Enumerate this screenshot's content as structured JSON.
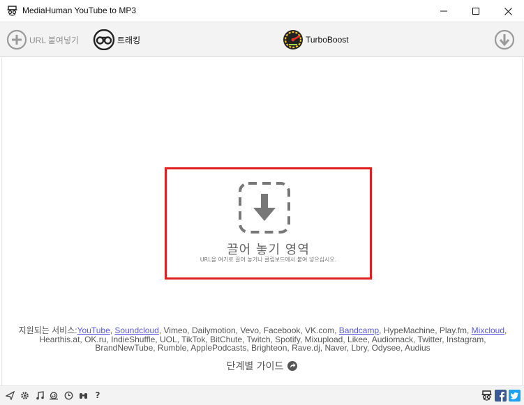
{
  "window": {
    "title": "MediaHuman YouTube to MP3"
  },
  "toolbar": {
    "paste_url_label": "URL 붙여넣기",
    "tracking_label": "트래킹",
    "turboboost_label": "TurboBoost"
  },
  "dropzone": {
    "title": "끌어 놓기 영역",
    "subtitle": "URL을 여기로 끌어 놓거나 클립보드에서 붙여 넣으십시오."
  },
  "services": {
    "intro": "지원되는 서비스:",
    "items": [
      {
        "name": "YouTube",
        "link": true
      },
      {
        "name": "Soundcloud",
        "link": true
      },
      {
        "name": "Vimeo",
        "link": false
      },
      {
        "name": "Dailymotion",
        "link": false
      },
      {
        "name": "Vevo",
        "link": false
      },
      {
        "name": "Facebook",
        "link": false
      },
      {
        "name": "VK.com",
        "link": false
      },
      {
        "name": "Bandcamp",
        "link": true
      },
      {
        "name": "HypeMachine",
        "link": false
      },
      {
        "name": "Play.fm",
        "link": false
      },
      {
        "name": "Mixcloud",
        "link": true
      },
      {
        "name": "Hearthis.at",
        "link": false
      },
      {
        "name": "OK.ru",
        "link": false
      },
      {
        "name": "IndieShuffle",
        "link": false
      },
      {
        "name": "UOL",
        "link": false
      },
      {
        "name": "TikTok",
        "link": false
      },
      {
        "name": "BitChute",
        "link": false
      },
      {
        "name": "Twitch",
        "link": false
      },
      {
        "name": "Spotify",
        "link": false
      },
      {
        "name": "Mixupload",
        "link": false
      },
      {
        "name": "Likee",
        "link": false
      },
      {
        "name": "Audiomack",
        "link": false
      },
      {
        "name": "Twitter",
        "link": false
      },
      {
        "name": "Instagram",
        "link": false
      },
      {
        "name": "BrandNewTube",
        "link": false
      },
      {
        "name": "Rumble",
        "link": false
      },
      {
        "name": "ApplePodcasts",
        "link": false
      },
      {
        "name": "Brighteon",
        "link": false
      },
      {
        "name": "Rave.dj",
        "link": false
      },
      {
        "name": "Naver",
        "link": false
      },
      {
        "name": "Lbry",
        "link": false
      },
      {
        "name": "Odysee",
        "link": false
      },
      {
        "name": "Audius",
        "link": false
      }
    ]
  },
  "guide": {
    "label": "단계별 가이드"
  },
  "statusbar": {
    "left_icons": [
      "send-icon",
      "gear-icon",
      "music-note-icon",
      "snail-icon",
      "clock-icon",
      "binoculars-icon",
      "help-icon"
    ],
    "right_icons": [
      "mediahuman-icon",
      "facebook-icon",
      "twitter-icon"
    ]
  },
  "colors": {
    "dropzone_border": "#e02020",
    "link": "#5a5adb",
    "facebook": "#3b5998",
    "twitter": "#1da1f2"
  }
}
